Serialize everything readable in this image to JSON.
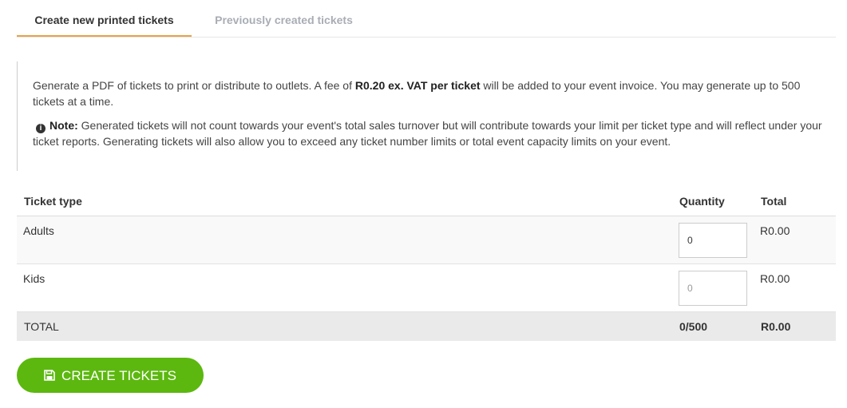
{
  "tabs": [
    {
      "label": "Create new printed tickets",
      "active": true
    },
    {
      "label": "Previously created tickets",
      "active": false
    }
  ],
  "info": {
    "p1_before": "Generate a PDF of tickets to print or distribute to outlets. A fee of ",
    "p1_bold": "R0.20 ex. VAT per ticket",
    "p1_after": " will be added to your event invoice. You may generate up to 500 tickets at a time.",
    "note_label": "Note:",
    "note_text": " Generated tickets will not count towards your event's total sales turnover but will contribute towards your limit per ticket type and will reflect under your ticket reports. Generating tickets will also allow you to exceed any ticket number limits or total event capacity limits on your event.",
    "icon": "info-circle-icon"
  },
  "table": {
    "headers": {
      "type": "Ticket type",
      "quantity": "Quantity",
      "total": "Total"
    },
    "rows": [
      {
        "type": "Adults",
        "quantity_value": "0",
        "quantity_placeholder": "0",
        "total": "R0.00"
      },
      {
        "type": "Kids",
        "quantity_value": "",
        "quantity_placeholder": "0",
        "total": "R0.00"
      }
    ],
    "footer": {
      "label": "TOTAL",
      "quantity": "0/500",
      "total": "R0.00"
    }
  },
  "button": {
    "label": "CREATE TICKETS",
    "icon": "save-icon"
  },
  "colors": {
    "accent_tab": "#e8a24a",
    "button_green": "#5cb80f"
  }
}
